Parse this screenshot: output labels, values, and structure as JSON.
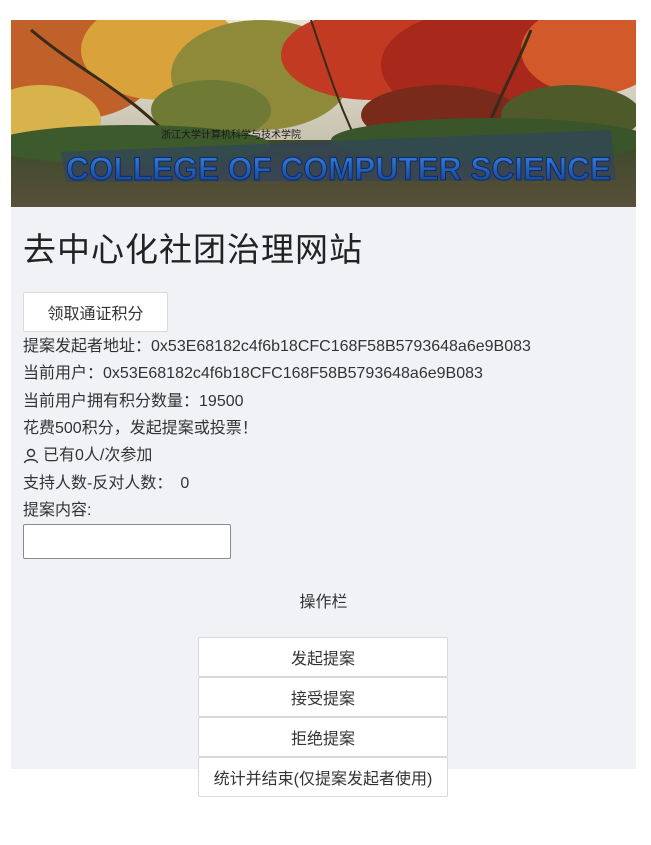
{
  "banner": {
    "sign_text": "COLLEGE OF COMPUTER SCIENCE",
    "sign_subtitle": "浙江大学计算机科学与技术学院"
  },
  "header": {
    "title": "去中心化社团治理网站"
  },
  "actions": {
    "claim_label": "领取通证积分"
  },
  "info": {
    "proposer_label": "提案发起者地址：",
    "proposer_address": "0x53E68182c4f6b18CFC168F58B5793648a6e9B083",
    "user_label": "当前用户：",
    "user_address": "0x53E68182c4f6b18CFC168F58B5793648a6e9B083",
    "points_label": "当前用户拥有积分数量：",
    "points": "19500",
    "cost_note": "花费500积分，发起提案或投票！",
    "participants_text": "已有0人/次参加",
    "vote_diff_label": "支持人数-反对人数：",
    "vote_diff": "0",
    "content_label": "提案内容:"
  },
  "proposal_input": {
    "value": "",
    "placeholder": ""
  },
  "operations": {
    "title": "操作栏",
    "buttons": [
      "发起提案",
      "接受提案",
      "拒绝提案",
      "统计并结束(仅提案发起者使用)"
    ]
  },
  "colors": {
    "panel_bg": "#f0f2f5",
    "sign_blue": "#1d5fc4"
  },
  "icons": {
    "participants": "user-icon"
  }
}
